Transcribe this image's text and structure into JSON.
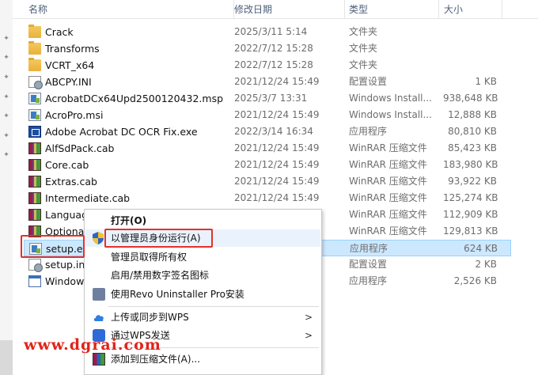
{
  "header": {
    "name": "名称",
    "date": "修改日期",
    "type": "类型",
    "size": "大小"
  },
  "files": [
    {
      "name": "Crack",
      "date": "2025/3/11 5:14",
      "type": "文件夹",
      "size": "",
      "icon": "folder-icon"
    },
    {
      "name": "Transforms",
      "date": "2022/7/12 15:28",
      "type": "文件夹",
      "size": "",
      "icon": "folder-icon"
    },
    {
      "name": "VCRT_x64",
      "date": "2022/7/12 15:28",
      "type": "文件夹",
      "size": "",
      "icon": "folder-icon"
    },
    {
      "name": "ABCPY.INI",
      "date": "2021/12/24 15:49",
      "type": "配置设置",
      "size": "1 KB",
      "icon": "ini-file-icon"
    },
    {
      "name": "AcrobatDCx64Upd2500120432.msp",
      "date": "2025/3/7 13:31",
      "type": "Windows Install...",
      "size": "938,648 KB",
      "icon": "msi-file-icon"
    },
    {
      "name": "AcroPro.msi",
      "date": "2021/12/24 15:49",
      "type": "Windows Install...",
      "size": "12,888 KB",
      "icon": "msi-file-icon"
    },
    {
      "name": "Adobe Acrobat DC OCR Fix.exe",
      "date": "2022/3/14 16:34",
      "type": "应用程序",
      "size": "80,810 KB",
      "icon": "exe-file-icon"
    },
    {
      "name": "AlfSdPack.cab",
      "date": "2021/12/24 15:49",
      "type": "WinRAR 压缩文件",
      "size": "85,423 KB",
      "icon": "winrar-archive-icon"
    },
    {
      "name": "Core.cab",
      "date": "2021/12/24 15:49",
      "type": "WinRAR 压缩文件",
      "size": "183,980 KB",
      "icon": "winrar-archive-icon"
    },
    {
      "name": "Extras.cab",
      "date": "2021/12/24 15:49",
      "type": "WinRAR 压缩文件",
      "size": "93,922 KB",
      "icon": "winrar-archive-icon"
    },
    {
      "name": "Intermediate.cab",
      "date": "2021/12/24 15:49",
      "type": "WinRAR 压缩文件",
      "size": "125,274 KB",
      "icon": "winrar-archive-icon"
    },
    {
      "name": "Languag",
      "date": "",
      "type": "WinRAR 压缩文件",
      "size": "112,909 KB",
      "icon": "winrar-archive-icon"
    },
    {
      "name": "Optiona",
      "date": "",
      "type": "WinRAR 压缩文件",
      "size": "129,813 KB",
      "icon": "winrar-archive-icon"
    },
    {
      "name": "setup.ex",
      "date": "",
      "type": "应用程序",
      "size": "624 KB",
      "icon": "msi-file-icon",
      "selected": true
    },
    {
      "name": "setup.ini",
      "date": "",
      "type": "配置设置",
      "size": "2 KB",
      "icon": "ini-file-icon"
    },
    {
      "name": "Window",
      "date": "",
      "type": "应用程序",
      "size": "2,526 KB",
      "icon": "window-app-icon"
    }
  ],
  "context_menu": {
    "open": "打开(O)",
    "run_as_admin": "以管理员身份运行(A)",
    "take_ownership": "管理员取得所有权",
    "toggle_signature": "启用/禁用数字签名图标",
    "revo_install": "使用Revo Uninstaller Pro安装",
    "wps_upload": "上传或同步到WPS",
    "wps_send": "通过WPS发送",
    "add_archive": "添加到压缩文件(A)...",
    "submenu_arrow": ">"
  },
  "watermark": "www.dgrai.com",
  "colors": {
    "selection": "#cce8ff",
    "highlight_box": "#e4312b",
    "watermark": "#e2231a"
  }
}
